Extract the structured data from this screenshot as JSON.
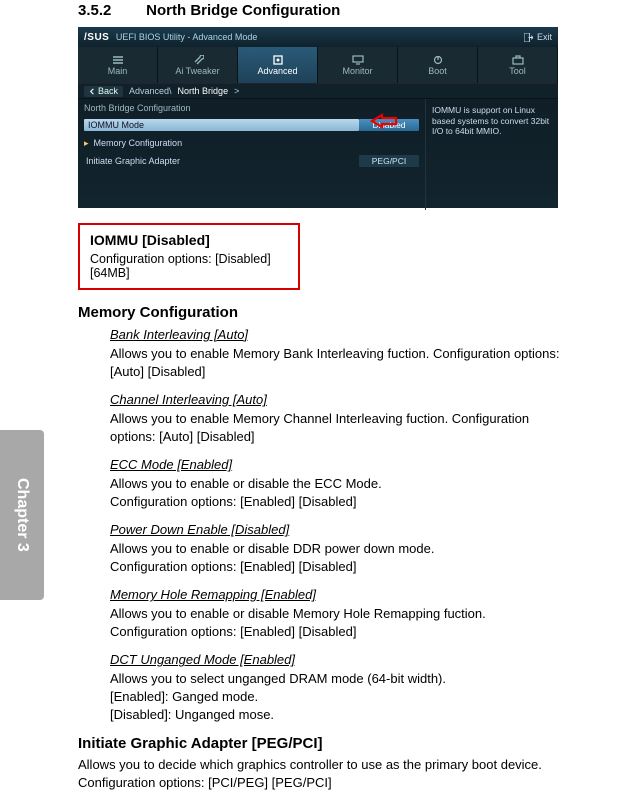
{
  "sideTab": "Chapter 3",
  "section": {
    "number": "3.5.2",
    "title": "North Bridge Configuration"
  },
  "bios": {
    "brand": "/SUS",
    "utility": "UEFI BIOS Utility - Advanced Mode",
    "exit": "Exit",
    "tabs": [
      "Main",
      "Ai Tweaker",
      "Advanced",
      "Monitor",
      "Boot",
      "Tool"
    ],
    "back": "Back",
    "crumbPrefix": "Advanced\\",
    "crumbCurrent": "North Bridge",
    "crumbArrow": ">",
    "groupTitle": "North Bridge Configuration",
    "rows": {
      "iommu": {
        "label": "IOMMU Mode",
        "value": "Disabled"
      },
      "memcfg": {
        "label": "Memory Configuration"
      },
      "iga": {
        "label": "Initiate Graphic Adapter",
        "value": "PEG/PCI"
      }
    },
    "help": "IOMMU is support on Linux based systems to convert 32bit I/O to 64bit MMIO."
  },
  "highlight": {
    "title": "IOMMU [Disabled]",
    "options": "Configuration options: [Disabled] [64MB]"
  },
  "memCfg": {
    "heading": "Memory Configuration",
    "items": [
      {
        "name": "Bank Interleaving [Auto]",
        "desc": "Allows you to enable Memory Bank Interleaving fuction. Configuration options: [Auto] [Disabled]"
      },
      {
        "name": "Channel Interleaving [Auto]",
        "desc": "Allows you to enable Memory Channel Interleaving fuction. Configuration options: [Auto] [Disabled]"
      },
      {
        "name": "ECC Mode [Enabled]",
        "desc": "Allows you to enable or disable the ECC Mode.\nConfiguration options: [Enabled] [Disabled]"
      },
      {
        "name": "Power Down Enable [Disabled]",
        "desc": "Allows you to enable or disable DDR power down mode.\nConfiguration options: [Enabled] [Disabled]"
      },
      {
        "name": "Memory Hole Remapping [Enabled]",
        "desc": "Allows you to enable or disable Memory Hole Remapping fuction.\nConfiguration options: [Enabled] [Disabled]"
      },
      {
        "name": "DCT Unganged Mode [Enabled]",
        "desc": "Allows you to select unganged DRAM mode (64-bit width).\n[Enabled]: Ganged mode.\n[Disabled]: Unganged mose."
      }
    ]
  },
  "iga": {
    "heading": "Initiate Graphic Adapter [PEG/PCI]",
    "desc": "Allows you to decide which graphics controller to use as the primary boot device.\nConfiguration options: [PCI/PEG] [PEG/PCI]"
  }
}
